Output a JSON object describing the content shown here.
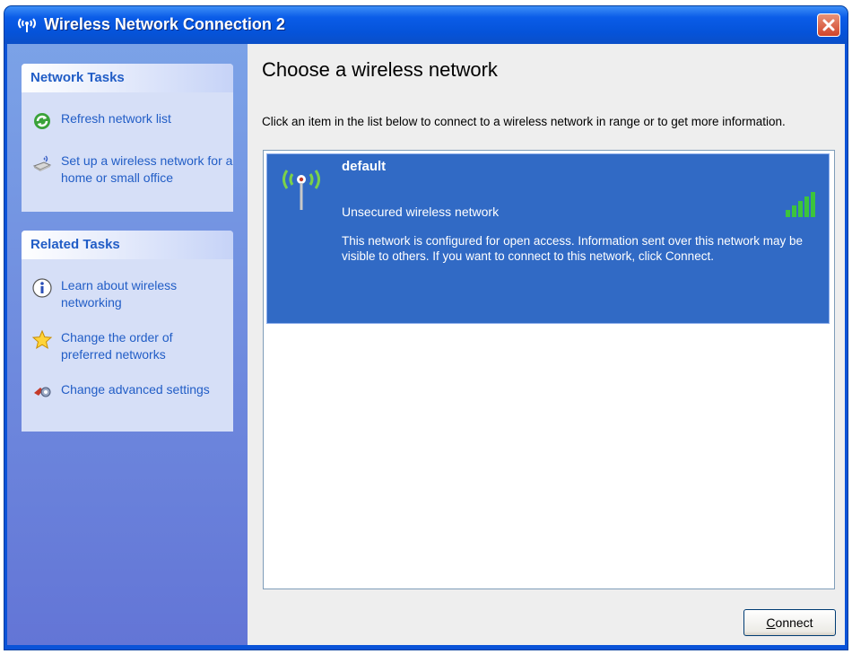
{
  "window": {
    "title": "Wireless Network Connection 2"
  },
  "sidebar": {
    "network_tasks": {
      "header": "Network Tasks",
      "items": [
        {
          "label": "Refresh network list",
          "icon": "refresh-icon"
        },
        {
          "label": "Set up a wireless network for a home or small office",
          "icon": "wireless-setup-icon"
        }
      ]
    },
    "related_tasks": {
      "header": "Related Tasks",
      "items": [
        {
          "label": "Learn about wireless networking",
          "icon": "info-icon"
        },
        {
          "label": "Change the order of preferred networks",
          "icon": "star-icon"
        },
        {
          "label": "Change advanced settings",
          "icon": "settings-icon"
        }
      ]
    }
  },
  "main": {
    "heading": "Choose a wireless network",
    "instructions": "Click an item in the list below to connect to a wireless network in range or to get more information.",
    "networks": [
      {
        "name": "default",
        "security": "Unsecured wireless network",
        "description": "This network is configured for open access. Information sent over this network may be visible to others. If you want to connect to this network, click Connect.",
        "signal_bars": 5,
        "signal_max": 5,
        "selected": true
      }
    ],
    "connect_label": "Connect"
  },
  "colors": {
    "title_bar": "#0553d9",
    "sidebar": "#6f8fe0",
    "task_link": "#215dc6",
    "selection": "#316ac5",
    "signal": "#3cc43c"
  }
}
